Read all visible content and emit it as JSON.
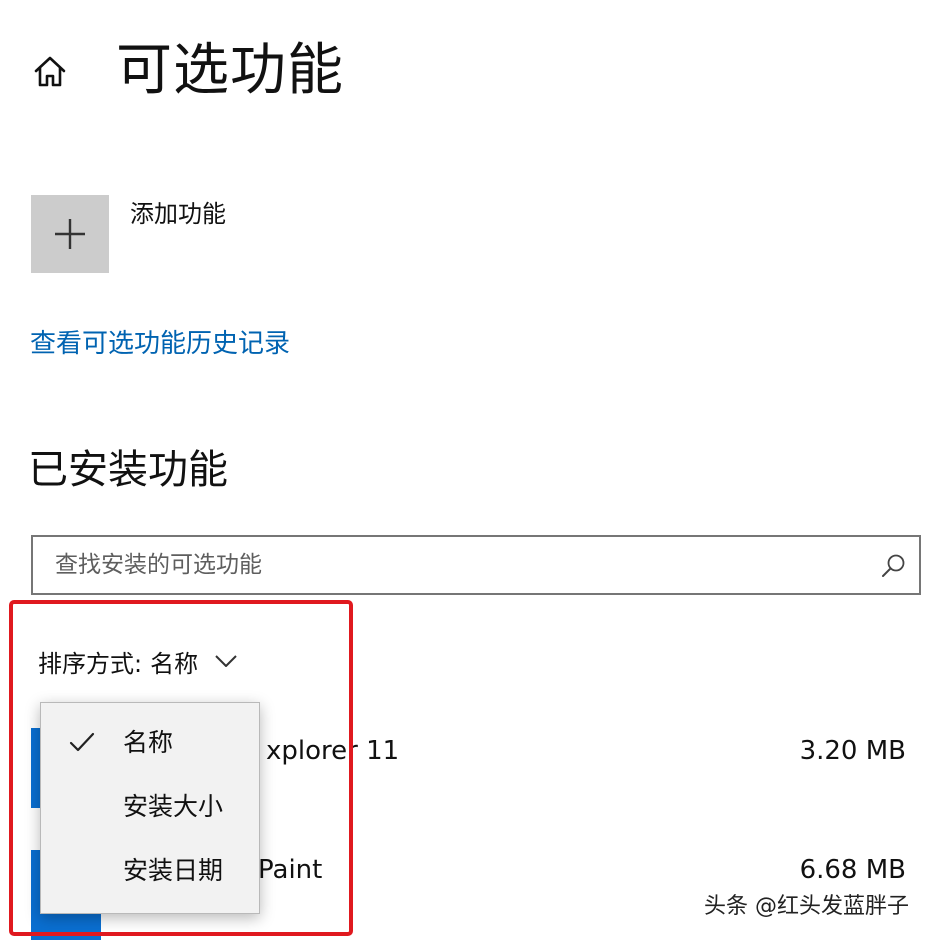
{
  "header": {
    "title": "可选功能"
  },
  "add_feature": {
    "label": "添加功能"
  },
  "history_link": {
    "label": "查看可选功能历史记录"
  },
  "installed": {
    "heading": "已安装功能",
    "search_placeholder": "查找安装的可选功能",
    "search_value": ""
  },
  "sort": {
    "label": "排序方式:",
    "selected": "名称",
    "options": [
      {
        "label": "名称",
        "checked": true
      },
      {
        "label": "安装大小",
        "checked": false
      },
      {
        "label": "安装日期",
        "checked": false
      }
    ]
  },
  "features": [
    {
      "name_visible": "xplorer 11",
      "size": "3.20 MB"
    },
    {
      "name_visible": "Paint",
      "size": "6.68 MB"
    }
  ],
  "watermark": "头条 @红头发蓝胖子",
  "colors": {
    "link": "#0063b1",
    "highlight": "#e0191f",
    "tile": "#cccccc",
    "item_icon": "#0a6fd1"
  }
}
